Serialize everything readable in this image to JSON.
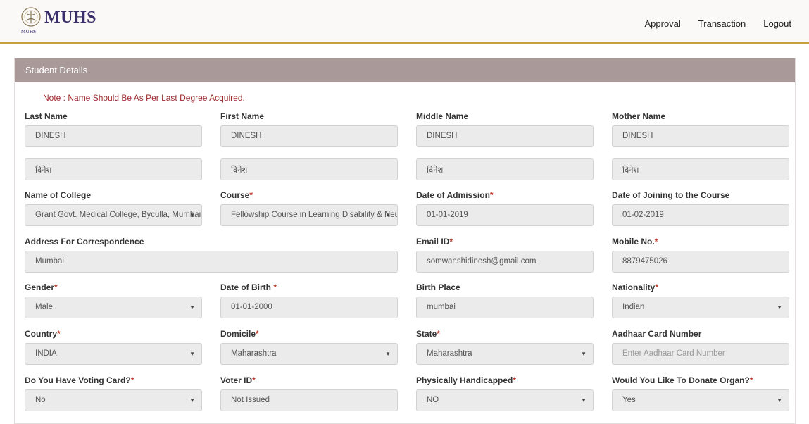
{
  "brand": {
    "name": "MUHS",
    "sub": "MUHS"
  },
  "nav": [
    "Approval",
    "Transaction",
    "Logout"
  ],
  "panel_title": "Student Details",
  "note": "Note : Name Should Be As Per Last Degree Acquired.",
  "fields": {
    "last_name": {
      "label": "Last Name",
      "value": "DINESH",
      "value_hindi": "दिनेश"
    },
    "first_name": {
      "label": "First Name",
      "value": "DINESH",
      "value_hindi": "दिनेश"
    },
    "middle_name": {
      "label": "Middle Name",
      "value": "DINESH",
      "value_hindi": "दिनेश"
    },
    "mother_name": {
      "label": "Mother Name",
      "value": "DINESH",
      "value_hindi": "दिनेश"
    },
    "college": {
      "label": "Name of College",
      "value": "Grant Govt. Medical College, Byculla, Mumbai"
    },
    "course": {
      "label": "Course",
      "value": "Fellowship Course in Learning Disability & Neuro"
    },
    "admission_date": {
      "label": "Date of Admission",
      "value": "01-01-2019"
    },
    "joining_date": {
      "label": "Date of Joining to the Course",
      "value": "01-02-2019"
    },
    "address": {
      "label": "Address For Correspondence",
      "value": "Mumbai"
    },
    "email": {
      "label": "Email ID",
      "value": "somwanshidinesh@gmail.com"
    },
    "mobile": {
      "label": "Mobile No.",
      "value": "8879475026"
    },
    "gender": {
      "label": "Gender",
      "value": "Male"
    },
    "dob": {
      "label": "Date of Birth ",
      "value": "01-01-2000"
    },
    "birth_place": {
      "label": "Birth Place",
      "value": "mumbai"
    },
    "nationality": {
      "label": "Nationality",
      "value": "Indian"
    },
    "country": {
      "label": "Country",
      "value": "INDIA"
    },
    "domicile": {
      "label": "Domicile",
      "value": "Maharashtra"
    },
    "state": {
      "label": "State",
      "value": "Maharashtra"
    },
    "aadhaar": {
      "label": "Aadhaar Card Number",
      "placeholder": "Enter Aadhaar Card Number"
    },
    "voting_card": {
      "label": "Do You Have Voting Card?",
      "value": "No"
    },
    "voter_id": {
      "label": "Voter ID",
      "value": "Not Issued"
    },
    "handicapped": {
      "label": "Physically Handicapped",
      "value": "NO"
    },
    "donate_organ": {
      "label": "Would You Like To Donate Organ?",
      "value": "Yes"
    }
  },
  "required_mark": "*",
  "dropdown_glyph": "▼"
}
